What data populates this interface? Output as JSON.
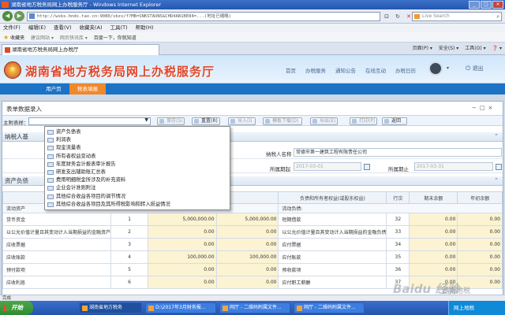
{
  "window": {
    "title": "湖南省地方税务局网上办税服务厅 - Windows Internet Explorer",
    "controls": [
      "_",
      "□",
      "×"
    ]
  },
  "browser": {
    "address": "http://wsbs.hnds.tax.cn:9080/sbzx/f?MB=SNKSTAUNS&CHD4AB1BE84=...(地址已缩略)",
    "search_placeholder": "Live Search",
    "menu": [
      "文件(F)",
      "编辑(E)",
      "查看(V)",
      "收藏夹(A)",
      "工具(T)",
      "帮助(H)"
    ],
    "favorites": {
      "label": "收藏夹",
      "items": [
        "建议网站 ▾",
        "网页快讯库 ▾",
        "百度一下，你就知道"
      ]
    },
    "tab_title": "湖南省地方税务局网上办税厅",
    "tools": [
      "页面(P) ▾",
      "安全(S) ▾",
      "工具(O) ▾",
      "❓ ▾"
    ]
  },
  "site": {
    "title": "湖南省地方税务局网上办税服务厅",
    "nav": [
      "首页",
      "办税服务",
      "通知公告",
      "在线互动",
      "办税日历"
    ],
    "logout": "退出",
    "app_nav": {
      "user_center": "用户页",
      "tax_report": "税表填报"
    }
  },
  "panel": {
    "title": "表单数据录入",
    "main_table_label": "主附表样：",
    "buttons": {
      "save": "保存(S)",
      "reset": "重置(R)",
      "import": "导入(I)",
      "template": "模板下载(D)",
      "export": "导出(E)",
      "print": "打印(P)",
      "back": "返回"
    }
  },
  "dropdown": {
    "items": [
      "资产负债表",
      "利润表",
      "现金流量表",
      "所有者权益变动表",
      "年度财务会计报表审计报告",
      "研发支出辅助账汇总表",
      "费用明细税金所涉及的补充资料",
      "企业会计准则附注",
      "其他综合收益各项目的调节情况",
      "其他综合收益各项目及其所得税影响和转入损益情况"
    ]
  },
  "taxpayer": {
    "section": "纳税人基",
    "name_label": "纳税人名称",
    "name_value": "常德市第一建筑工程有限责任公司",
    "period_label": "所属期起",
    "period_start": "2017-03-01",
    "period_end_label": "所属期止",
    "period_end": "2017-03-31"
  },
  "balance": {
    "section": "资产负债",
    "headers": [
      "负债和所有者权益(或股东权益)",
      "行次",
      "期末余额",
      "年初余额"
    ],
    "left_sub": "流动资产",
    "right_sub": "流动负债:",
    "rows": [
      {
        "left": "货币资金",
        "lno": "1",
        "lend": "5,000,000.00",
        "lbeg": "5,000,000.00",
        "right": "短期借款",
        "rno": "32",
        "rend": "0.00",
        "rbeg": "0.00"
      },
      {
        "left": "以公允价值计量且其变动计入当期损益的金融资产",
        "lno": "2",
        "lend": "0.00",
        "lbeg": "0.00",
        "right": "以公允价值计量且其变动计入当期损益的金融负债",
        "rno": "33",
        "rend": "0.00",
        "rbeg": "0.00"
      },
      {
        "left": "应收票据",
        "lno": "3",
        "lend": "0.00",
        "lbeg": "0.00",
        "right": "应付票据",
        "rno": "34",
        "rend": "0.00",
        "rbeg": "0.00"
      },
      {
        "left": "应收账款",
        "lno": "4",
        "lend": "100,000.00",
        "lbeg": "100,000.00",
        "right": "应付账款",
        "rno": "35",
        "rend": "0.00",
        "rbeg": "0.00"
      },
      {
        "left": "预付款项",
        "lno": "5",
        "lend": "0.00",
        "lbeg": "0.00",
        "right": "预收款项",
        "rno": "36",
        "rend": "0.00",
        "rbeg": "0.00"
      },
      {
        "left": "应收利息",
        "lno": "6",
        "lend": "0.00",
        "lbeg": "0.00",
        "right": "应付职工薪酬",
        "rno": "37",
        "rend": "0.00",
        "rbeg": "0.00"
      }
    ]
  },
  "status": {
    "left": "完成"
  },
  "taskbar": {
    "start": "开始",
    "items": [
      "湖南省地方税务",
      "D:\\2017年3月财务报...",
      "网厅 - 二维码附属文件...",
      "网厅 - 二维码附属文件..."
    ],
    "tray": "网上地税"
  },
  "watermark": {
    "main": "Baidu 经验",
    "sub": "湖南地税"
  },
  "colors": {
    "title_red": "#e0452a",
    "nav_blue": "#1c72c4",
    "nav_orange": "#f0882c",
    "cell_yellow": "#fbf3d2"
  }
}
